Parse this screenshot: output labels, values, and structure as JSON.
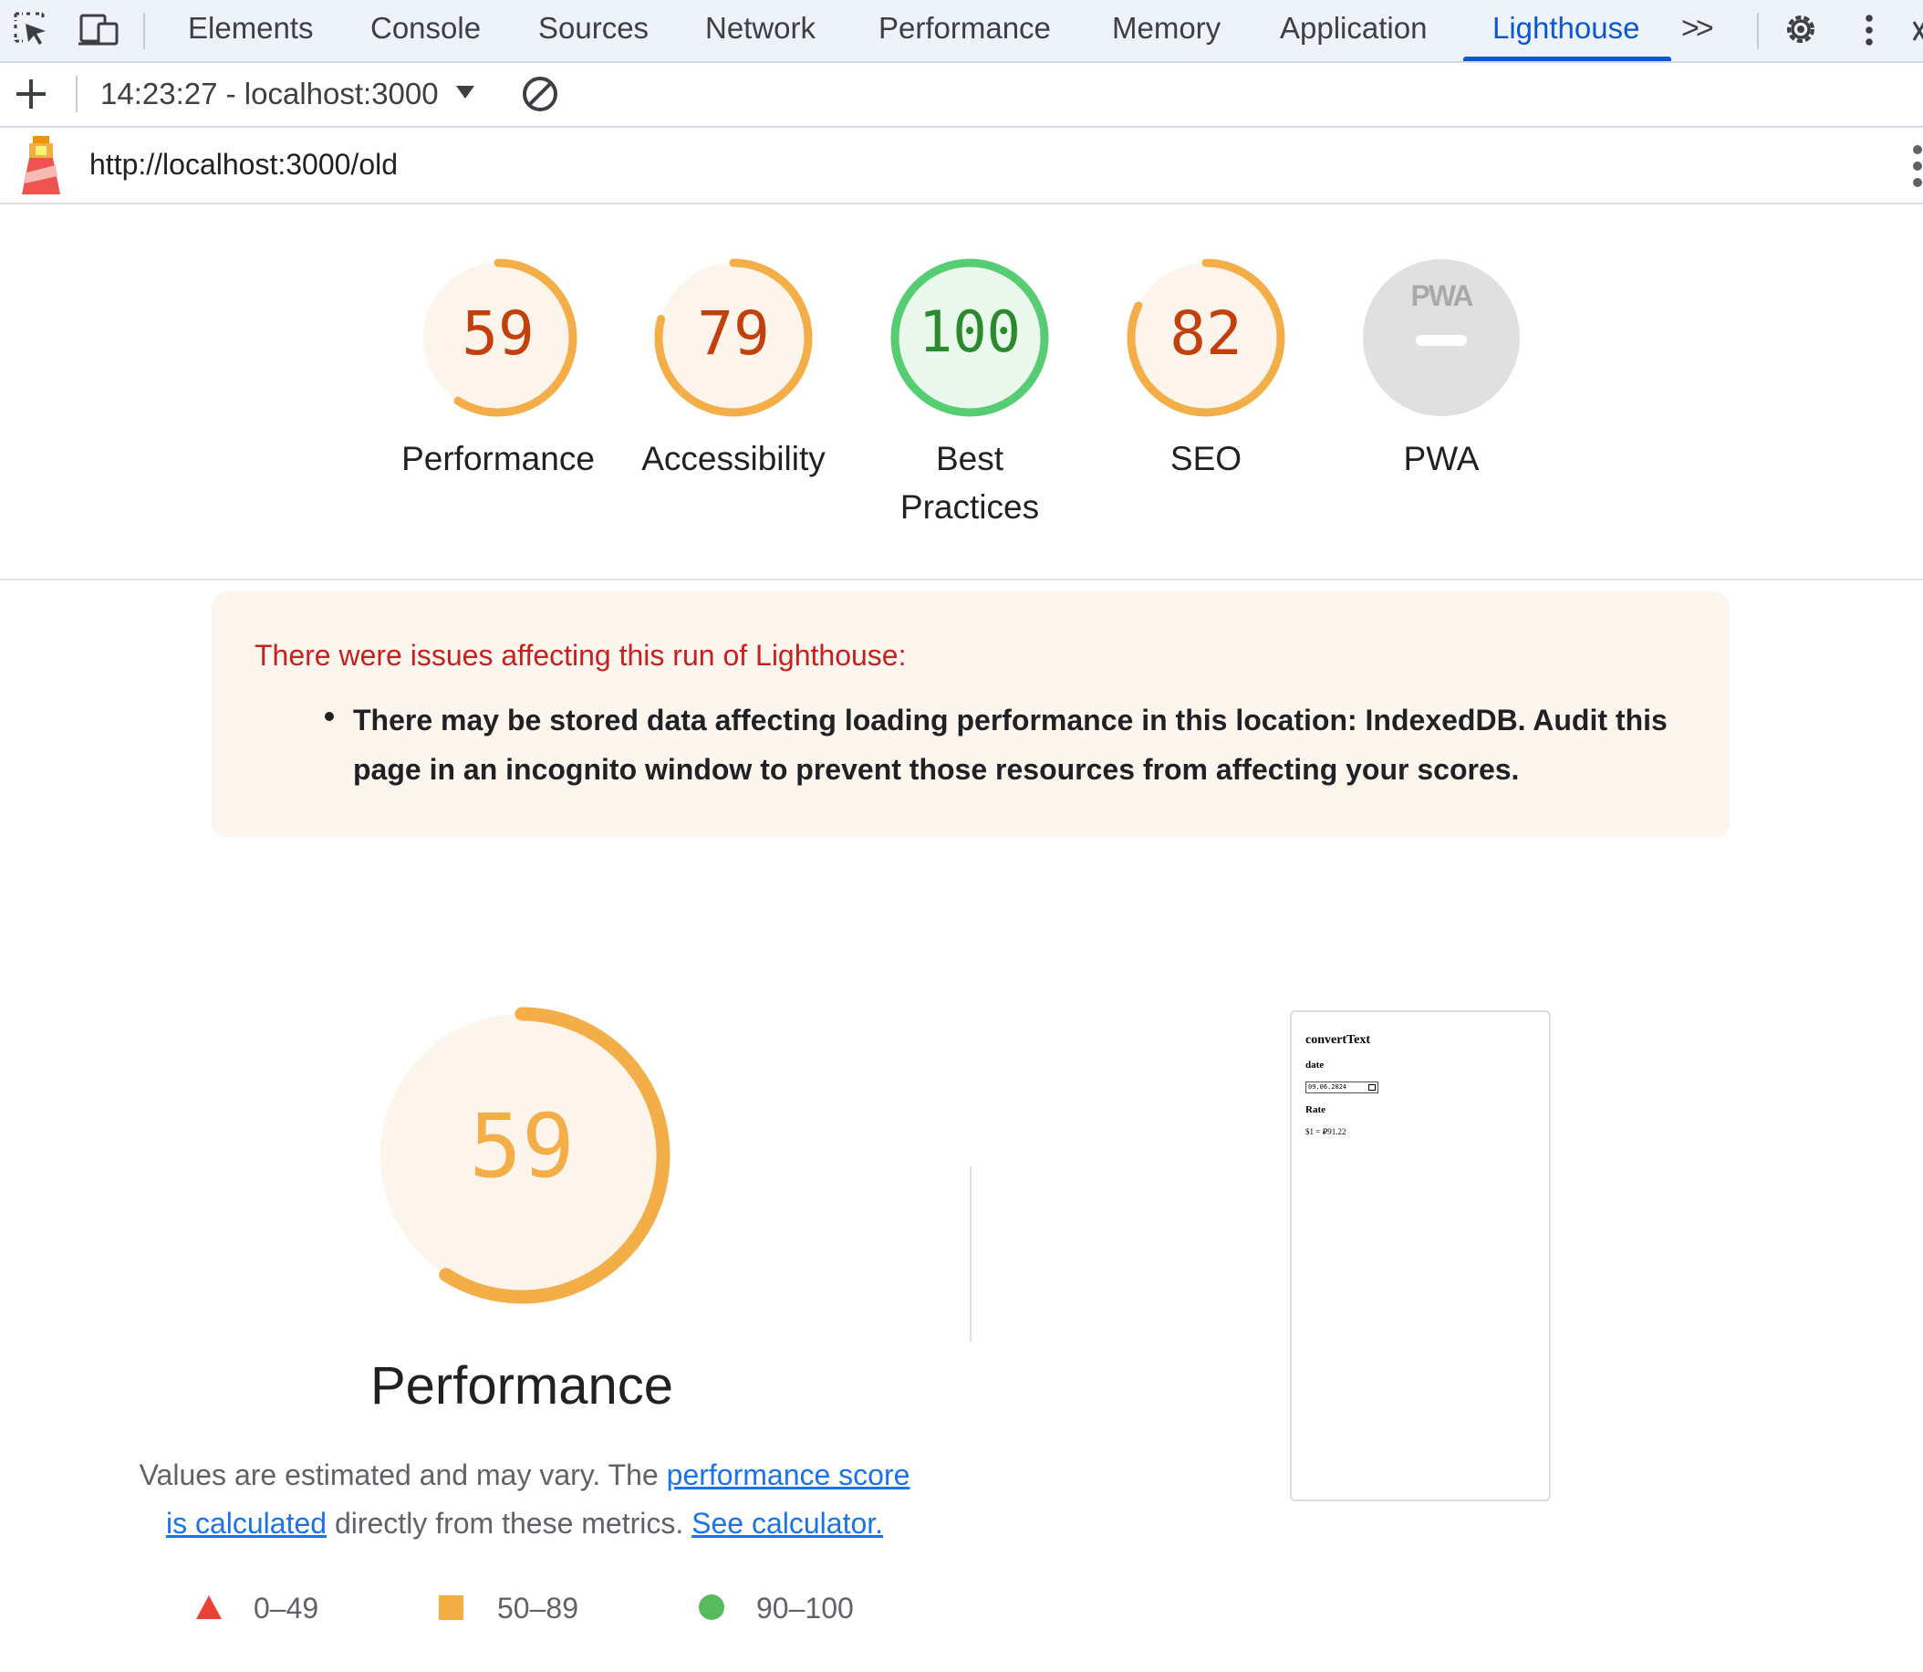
{
  "devtools": {
    "tabs": [
      "Elements",
      "Console",
      "Sources",
      "Network",
      "Performance",
      "Memory",
      "Application",
      "Lighthouse"
    ],
    "active_tab": "Lighthouse",
    "more_tabs_glyph": ">>"
  },
  "toolbar": {
    "report_selector": "14:23:27 - localhost:3000"
  },
  "report": {
    "url": "http://localhost:3000/old"
  },
  "categories": [
    {
      "label": "Performance",
      "score": "59",
      "fraction": 0.59,
      "status": "average"
    },
    {
      "label": "Accessibility",
      "score": "79",
      "fraction": 0.79,
      "status": "average"
    },
    {
      "label_line1": "Best",
      "label_line2": "Practices",
      "score": "100",
      "fraction": 1.0,
      "status": "pass"
    },
    {
      "label": "SEO",
      "score": "82",
      "fraction": 0.82,
      "status": "average"
    },
    {
      "label": "PWA",
      "score": "",
      "badge_text": "PWA",
      "status": "not-applicable"
    }
  ],
  "warning": {
    "title": "There were issues affecting this run of Lighthouse:",
    "items": [
      "There may be stored data affecting loading performance in this location: IndexedDB. Audit this page in an incognito window to prevent those resources from affecting your scores."
    ]
  },
  "performance": {
    "score": "59",
    "fraction": 0.59,
    "title": "Performance",
    "desc_prefix": "Values are estimated and may vary. The ",
    "desc_link1": "performance score is calculated",
    "desc_middle": " directly from these metrics. ",
    "desc_link2": "See calculator."
  },
  "legend": [
    {
      "label": "0–49",
      "shape": "triangle",
      "color": "#e94235"
    },
    {
      "label": "50–89",
      "shape": "square",
      "color": "#f4ae48"
    },
    {
      "label": "90–100",
      "shape": "circle",
      "color": "#57bb5d"
    }
  ],
  "final_screenshot": {
    "heading": "convertText",
    "date_label": "date",
    "date_value": "09.06.2024",
    "rate_label": "Rate",
    "rate_value": "$1 = ₽91.22"
  },
  "colors": {
    "average_arc": "#f4ae48",
    "average_fill": "#fdf5eb",
    "average_text": "#c3400c",
    "pass_arc": "#57cd73",
    "pass_fill": "#ebf8ee",
    "pass_text": "#2b8a2e",
    "na_fill": "#e0e0e0",
    "accent": "#0b57d0"
  }
}
